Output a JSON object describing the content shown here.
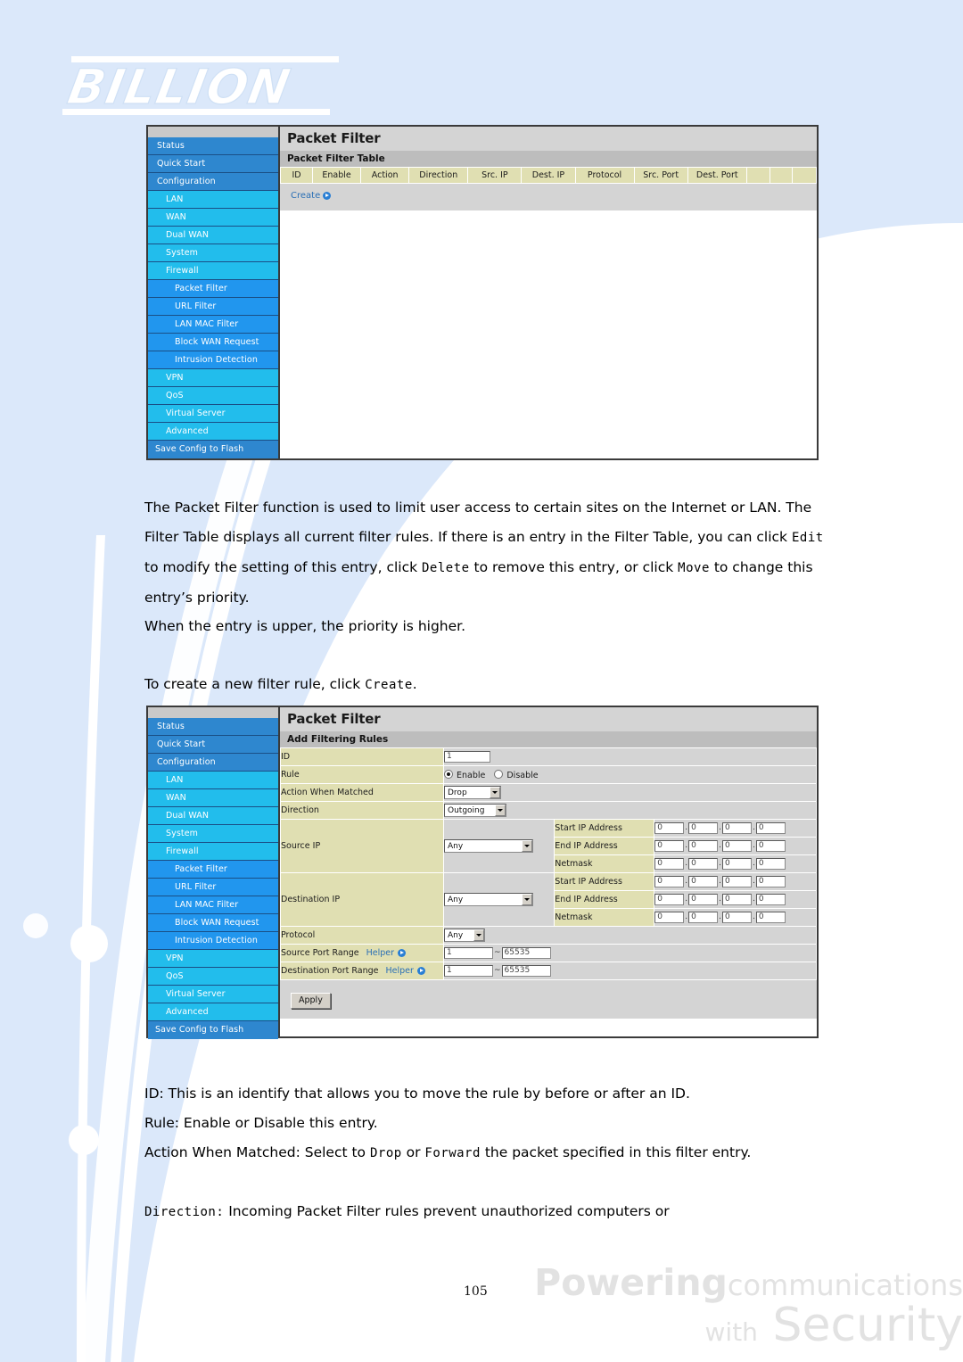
{
  "logo": {
    "text": "BILLION"
  },
  "sidebar": {
    "items": [
      {
        "label": "Status",
        "level": 0
      },
      {
        "label": "Quick Start",
        "level": 0
      },
      {
        "label": "Configuration",
        "level": 0
      },
      {
        "label": "LAN",
        "level": 1
      },
      {
        "label": "WAN",
        "level": 1
      },
      {
        "label": "Dual WAN",
        "level": 1
      },
      {
        "label": "System",
        "level": 1
      },
      {
        "label": "Firewall",
        "level": 1
      },
      {
        "label": "Packet Filter",
        "level": 2
      },
      {
        "label": "URL Filter",
        "level": 2
      },
      {
        "label": "LAN MAC Filter",
        "level": 2
      },
      {
        "label": "Block WAN Request",
        "level": 2
      },
      {
        "label": "Intrusion Detection",
        "level": 2
      },
      {
        "label": "VPN",
        "level": 1
      },
      {
        "label": "QoS",
        "level": 1
      },
      {
        "label": "Virtual Server",
        "level": 1
      },
      {
        "label": "Advanced",
        "level": 1
      },
      {
        "label": "Save Config to Flash",
        "level": 3
      }
    ]
  },
  "screenshot_table": {
    "title": "Packet Filter",
    "subtitle": "Packet Filter Table",
    "columns": [
      "ID",
      "Enable",
      "Action",
      "Direction",
      "Src. IP",
      "Dest. IP",
      "Protocol",
      "Src. Port",
      "Dest. Port",
      "",
      "",
      ""
    ],
    "rows": [],
    "create_label": "Create"
  },
  "screenshot_form": {
    "title": "Packet Filter",
    "subtitle": "Add Filtering Rules",
    "fields": {
      "id_label": "ID",
      "id_value": "1",
      "rule_label": "Rule",
      "rule_enable_label": "Enable",
      "rule_disable_label": "Disable",
      "rule_selected": "Enable",
      "action_label": "Action When Matched",
      "action_value": "Drop",
      "direction_label": "Direction",
      "direction_value": "Outgoing",
      "source_ip_label": "Source IP",
      "source_ip_mode": "Any",
      "destination_ip_label": "Destination IP",
      "destination_ip_mode": "Any",
      "start_ip_label": "Start IP Address",
      "end_ip_label": "End IP Address",
      "netmask_label": "Netmask",
      "octet_value": "0",
      "protocol_label": "Protocol",
      "protocol_value": "Any",
      "src_port_label": "Source Port Range",
      "dst_port_label": "Destination Port Range",
      "helper_label": "Helper",
      "port_from": "1",
      "port_to": "65535",
      "apply_label": "Apply"
    }
  },
  "body": {
    "p1_a": "The Packet Filter function is used to limit user access to certain sites on the Internet or LAN. The Filter Table displays all current filter rules. If there is an entry in the Filter Table, you can click ",
    "p1_edit": "Edit",
    "p1_b": " to modify the setting of this entry, click ",
    "p1_delete": "Delete",
    "p1_c": " to remove this entry, or click ",
    "p1_move": "Move",
    "p1_d": " to change this entry’s priority.",
    "p2": "When the entry is upper, the priority is higher.",
    "p3_a": "To create a new filter rule, click ",
    "p3_create": "Create",
    "p3_b": ".",
    "p4": "ID: This is an identify that allows you to move the rule by before or after an ID.",
    "p5": "Rule: Enable or Disable this entry.",
    "p6_a": "Action When Matched: Select to ",
    "p6_drop": "Drop",
    "p6_b": " or ",
    "p6_forward": "Forward",
    "p6_c": " the packet specified in this filter entry.",
    "p7_dir": "Direction:",
    "p7_rest": " Incoming Packet Filter rules prevent unauthorized computers or"
  },
  "footer": {
    "page_number": "105",
    "brand_line1_bold": "Powering",
    "brand_line1_light": "communications",
    "brand_line2_small": "with",
    "brand_line2_big": "Security"
  },
  "colors": {
    "nav_level0": "#2e87cf",
    "nav_level1": "#22bdec",
    "nav_level2": "#2196ee",
    "table_header": "#e0dfb2",
    "panel_bg": "#d4d4d4",
    "link": "#2a6fb5",
    "page_bg_blue": "#dbe8fa"
  }
}
